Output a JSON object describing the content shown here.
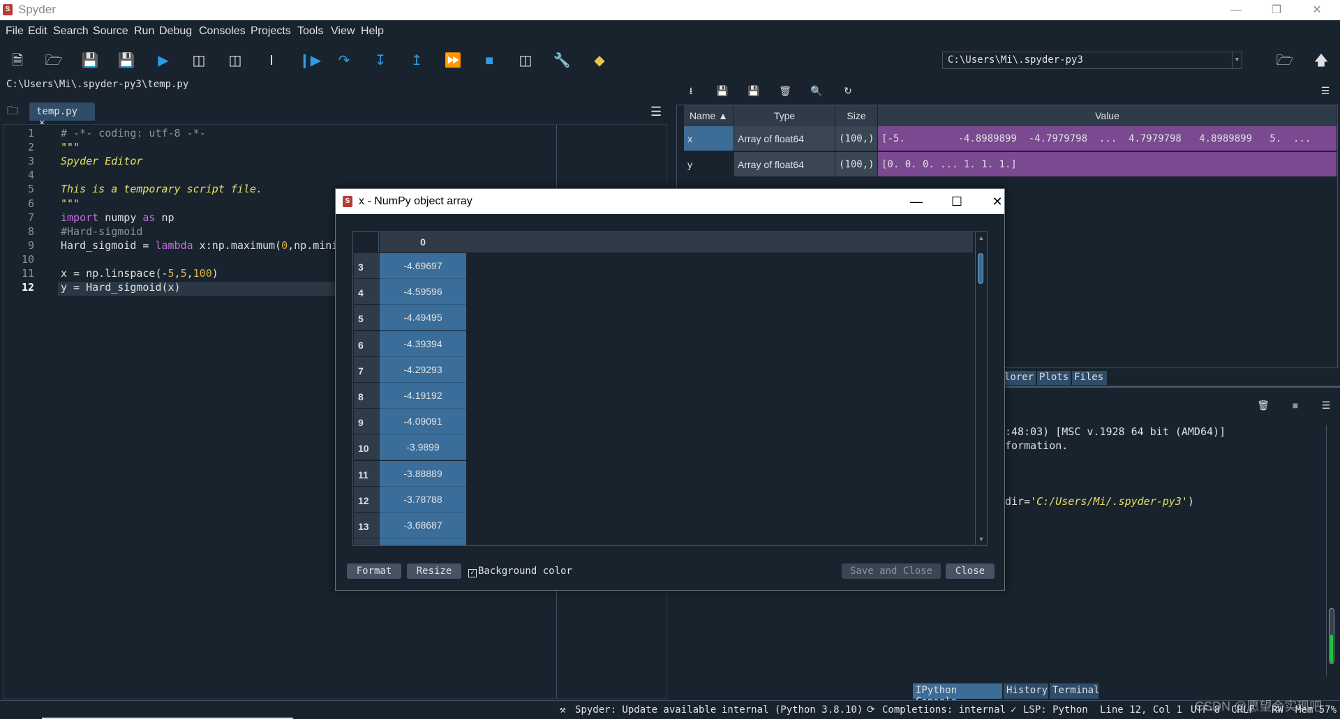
{
  "window": {
    "title": "Spyder",
    "app_icon": "spyder-icon"
  },
  "menu": [
    "File",
    "Edit",
    "Search",
    "Source",
    "Run",
    "Debug",
    "Consoles",
    "Projects",
    "Tools",
    "View",
    "Help"
  ],
  "toolbar": {
    "working_dir": "C:\\Users\\Mi\\.spyder-py3"
  },
  "editor": {
    "path": "C:\\Users\\Mi\\.spyder-py3\\temp.py",
    "tab_label": "temp.py",
    "current_line": 12,
    "lines": [
      "# -*- coding: utf-8 -*-",
      "\"\"\"",
      "Spyder Editor",
      "",
      "This is a temporary script file.",
      "\"\"\"",
      "import numpy as np",
      "#Hard-sigmoid",
      "Hard_sigmoid = lambda x:np.maximum(0,np.mini",
      "",
      "x = np.linspace(-5,5,100)",
      "y = Hard_sigmoid(x)"
    ]
  },
  "variable_explorer": {
    "columns": [
      "Name",
      "Type",
      "Size",
      "Value"
    ],
    "rows": [
      {
        "name": "x",
        "type": "Array of float64",
        "size": "(100,)",
        "value": "[-5.         -4.8989899  -4.7979798  ...  4.7979798   4.8989899   5.  ..."
      },
      {
        "name": "y",
        "type": "Array of float64",
        "size": "(100,)",
        "value": "[0. 0. 0. ... 1. 1. 1.]"
      }
    ],
    "pane_tabs": [
      "lorer",
      "Plots",
      "Files"
    ]
  },
  "console": {
    "lines": [
      ":48:03) [MSC v.1928 64 bit (AMD64)]",
      "formation."
    ],
    "wdir_prefix": "dir=",
    "wdir_value": "'C:/Users/Mi/.spyder-py3'",
    "wdir_suffix": ")"
  },
  "bottom_tabs": [
    "IPython Console",
    "History",
    "Terminal"
  ],
  "status": {
    "update": "Spyder: Update available",
    "interpreter": "internal (Python 3.8.10)",
    "completions": "Completions: internal",
    "lsp": "LSP: Python",
    "position": "Line 12, Col 1",
    "encoding": "UTF-8",
    "eol": "CRLF",
    "rw": "RW",
    "mem": "Mem 57%"
  },
  "watermark": "CSDN @愿望会实现吧",
  "dialog": {
    "title": "x - NumPy object array",
    "column_header": "0",
    "rows": [
      {
        "index": "3",
        "value": "-4.69697"
      },
      {
        "index": "4",
        "value": "-4.59596"
      },
      {
        "index": "5",
        "value": "-4.49495"
      },
      {
        "index": "6",
        "value": "-4.39394"
      },
      {
        "index": "7",
        "value": "-4.29293"
      },
      {
        "index": "8",
        "value": "-4.19192"
      },
      {
        "index": "9",
        "value": "-4.09091"
      },
      {
        "index": "10",
        "value": "-3.9899"
      },
      {
        "index": "11",
        "value": "-3.88889"
      },
      {
        "index": "12",
        "value": "-3.78788"
      },
      {
        "index": "13",
        "value": "-3.68687"
      }
    ],
    "buttons": {
      "format": "Format",
      "resize": "Resize",
      "save_close": "Save and Close",
      "close": "Close"
    },
    "background_color_label": "Background color",
    "background_color_checked": true
  }
}
